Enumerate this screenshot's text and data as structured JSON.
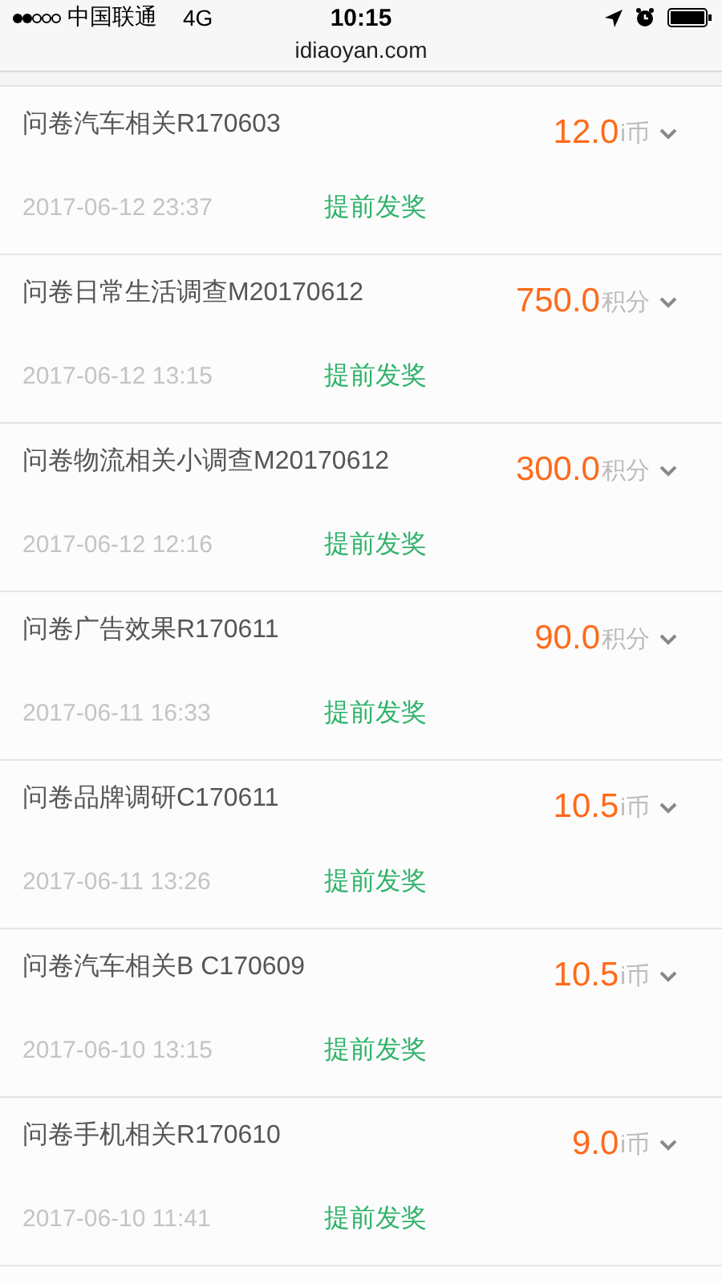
{
  "status_bar": {
    "carrier": "中国联通",
    "network": "4G",
    "time": "10:15"
  },
  "address_bar": {
    "url": "idiaoyan.com"
  },
  "records": [
    {
      "title": "问卷汽车相关R170603",
      "amount": "12.0",
      "unit": "i币",
      "date": "2017-06-12 23:37",
      "action": "提前发奖"
    },
    {
      "title": "问卷日常生活调查M20170612",
      "amount": "750.0",
      "unit": "积分",
      "date": "2017-06-12 13:15",
      "action": "提前发奖"
    },
    {
      "title": "问卷物流相关小调查M20170612",
      "amount": "300.0",
      "unit": "积分",
      "date": "2017-06-12 12:16",
      "action": "提前发奖"
    },
    {
      "title": "问卷广告效果R170611",
      "amount": "90.0",
      "unit": "积分",
      "date": "2017-06-11 16:33",
      "action": "提前发奖"
    },
    {
      "title": "问卷品牌调研C170611",
      "amount": "10.5",
      "unit": "i币",
      "date": "2017-06-11 13:26",
      "action": "提前发奖"
    },
    {
      "title": "问卷汽车相关B C170609",
      "amount": "10.5",
      "unit": "i币",
      "date": "2017-06-10 13:15",
      "action": "提前发奖"
    },
    {
      "title": "问卷手机相关R170610",
      "amount": "9.0",
      "unit": "i币",
      "date": "2017-06-10 11:41",
      "action": "提前发奖"
    }
  ]
}
